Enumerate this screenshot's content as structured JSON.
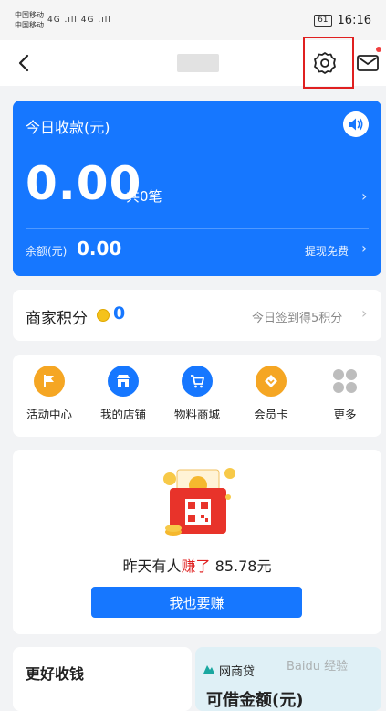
{
  "status_bar": {
    "carrier1": "中国移动",
    "carrier2": "中国移动",
    "signal": "4G .ıll 4G .ıll",
    "battery": "61",
    "time": "16:16"
  },
  "income": {
    "title": "今日收款(元)",
    "amount": "0.00",
    "count": "共0笔",
    "balance_label": "余额(元)",
    "balance_value": "0.00",
    "withdraw": "提现免费",
    "accent_color": "#1677ff"
  },
  "points": {
    "label": "商家积分",
    "value": "0",
    "signin": "今日签到得5积分"
  },
  "services": [
    {
      "label": "活动中心",
      "icon": "flag-icon",
      "color": "#f5a623"
    },
    {
      "label": "我的店铺",
      "icon": "shop-icon",
      "color": "#1677ff"
    },
    {
      "label": "物料商城",
      "icon": "cart-icon",
      "color": "#1677ff"
    },
    {
      "label": "会员卡",
      "icon": "member-card-icon",
      "color": "#f5a623"
    },
    {
      "label": "更多",
      "icon": "more-grid-icon",
      "color": "#999999"
    }
  ],
  "earn": {
    "text_before": "昨天有人",
    "text_highlight": "赚了",
    "text_after": " 85.78元",
    "button": "我也要赚"
  },
  "bottom": {
    "left_title": "更好收钱",
    "right_brand": "网商贷",
    "right_text": "可借金额(元)",
    "watermark": "Baidu 经验"
  }
}
